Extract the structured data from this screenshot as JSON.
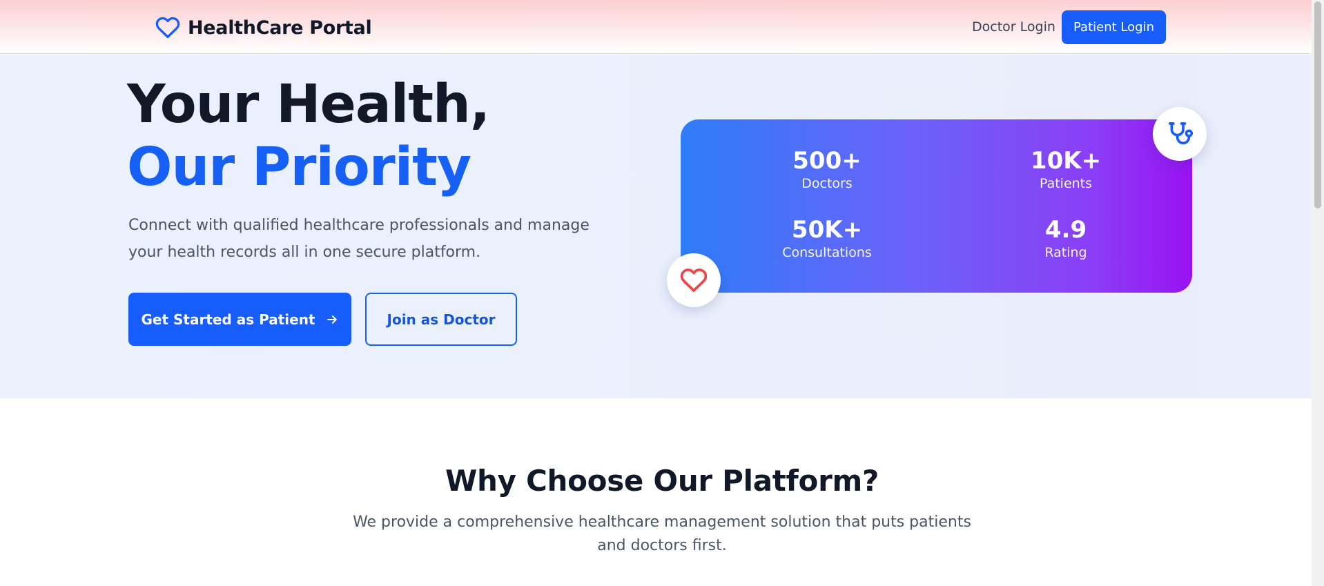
{
  "header": {
    "brand_name": "HealthCare Portal",
    "doctor_login": "Doctor Login",
    "patient_login": "Patient Login"
  },
  "hero": {
    "title_part1": "Your Health, ",
    "title_part2": "Our Priority",
    "description": "Connect with qualified healthcare professionals and manage your health records all in one secure platform.",
    "primary_button": "Get Started as Patient",
    "secondary_button": "Join as Doctor"
  },
  "stats": [
    {
      "value": "500+",
      "label": "Doctors"
    },
    {
      "value": "10K+",
      "label": "Patients"
    },
    {
      "value": "50K+",
      "label": "Consultations"
    },
    {
      "value": "4.9",
      "label": "Rating"
    }
  ],
  "why": {
    "title": "Why Choose Our Platform?",
    "description": "We provide a comprehensive healthcare management solution that puts patients and doctors first."
  },
  "icons": {
    "brand": "heart-icon",
    "primary_button": "arrow-right-icon",
    "card_top": "stethoscope-icon",
    "card_bottom": "heart-icon"
  },
  "colors": {
    "primary": "#165dfb",
    "heart_red": "#ef4444",
    "gradient_start": "#2f7df8",
    "gradient_end": "#9912f2"
  }
}
